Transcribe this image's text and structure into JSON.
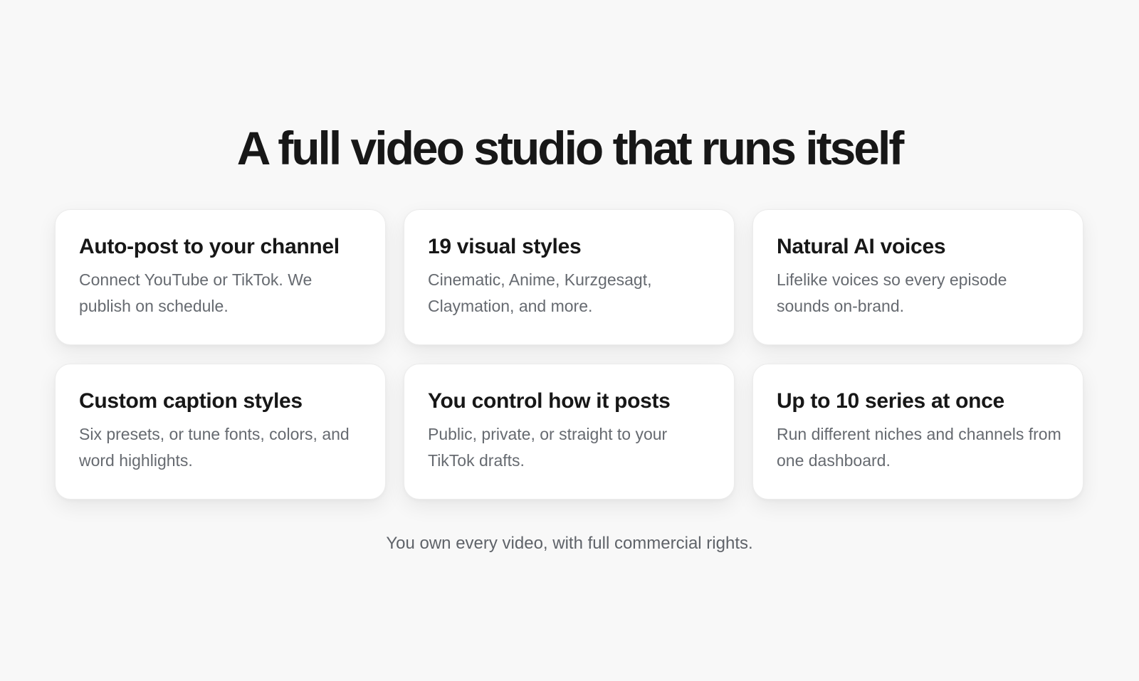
{
  "headline": "A full video studio that runs itself",
  "features": [
    {
      "title": "Auto-post to your channel",
      "description": "Connect YouTube or TikTok. We publish on schedule."
    },
    {
      "title": "19 visual styles",
      "description": "Cinematic, Anime, Kurzgesagt, Claymation, and more."
    },
    {
      "title": "Natural AI voices",
      "description": "Lifelike voices so every episode sounds on-brand."
    },
    {
      "title": "Custom caption styles",
      "description": "Six presets, or tune fonts, colors, and word highlights."
    },
    {
      "title": "You control how it posts",
      "description": "Public, private, or straight to your TikTok drafts."
    },
    {
      "title": "Up to 10 series at once",
      "description": "Run different niches and channels from one dashboard."
    }
  ],
  "footnote": "You own every video, with full commercial rights.",
  "colors": {
    "background": "#f8f8f8",
    "card": "#ffffff",
    "heading": "#171717",
    "body_text": "#666a70"
  }
}
